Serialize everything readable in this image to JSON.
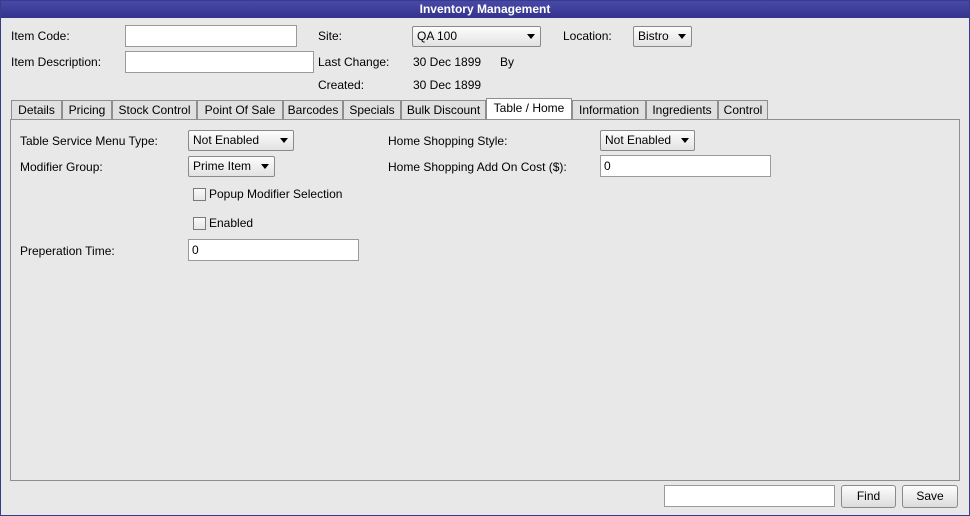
{
  "window": {
    "title": "Inventory Management"
  },
  "header": {
    "item_code_label": "Item Code:",
    "item_code_value": "",
    "item_description_label": "Item Description:",
    "item_description_value": "",
    "site_label": "Site:",
    "site_value": "QA 100",
    "location_label": "Location:",
    "location_value": "Bistro",
    "last_change_label": "Last Change:",
    "last_change_value": "30 Dec 1899",
    "by_label": "By",
    "created_label": "Created:",
    "created_value": "30 Dec 1899"
  },
  "tabs": [
    {
      "label": "Details"
    },
    {
      "label": "Pricing"
    },
    {
      "label": "Stock Control"
    },
    {
      "label": "Point Of Sale"
    },
    {
      "label": "Barcodes"
    },
    {
      "label": "Specials"
    },
    {
      "label": "Bulk Discount"
    },
    {
      "label": "Table / Home",
      "active": true
    },
    {
      "label": "Information"
    },
    {
      "label": "Ingredients"
    },
    {
      "label": "Control"
    }
  ],
  "panel": {
    "table_service_menu_type_label": "Table Service Menu Type:",
    "table_service_menu_type_value": "Not Enabled",
    "modifier_group_label": "Modifier Group:",
    "modifier_group_value": "Prime Item",
    "popup_modifier_selection_label": "Popup Modifier Selection",
    "enabled_label": "Enabled",
    "preparation_time_label": "Preperation Time:",
    "preparation_time_value": "0",
    "home_shopping_style_label": "Home Shopping Style:",
    "home_shopping_style_value": "Not Enabled",
    "home_shopping_add_on_cost_label": "Home Shopping Add On Cost ($):",
    "home_shopping_add_on_cost_value": "0"
  },
  "footer": {
    "search_value": "",
    "find_label": "Find",
    "save_label": "Save"
  }
}
